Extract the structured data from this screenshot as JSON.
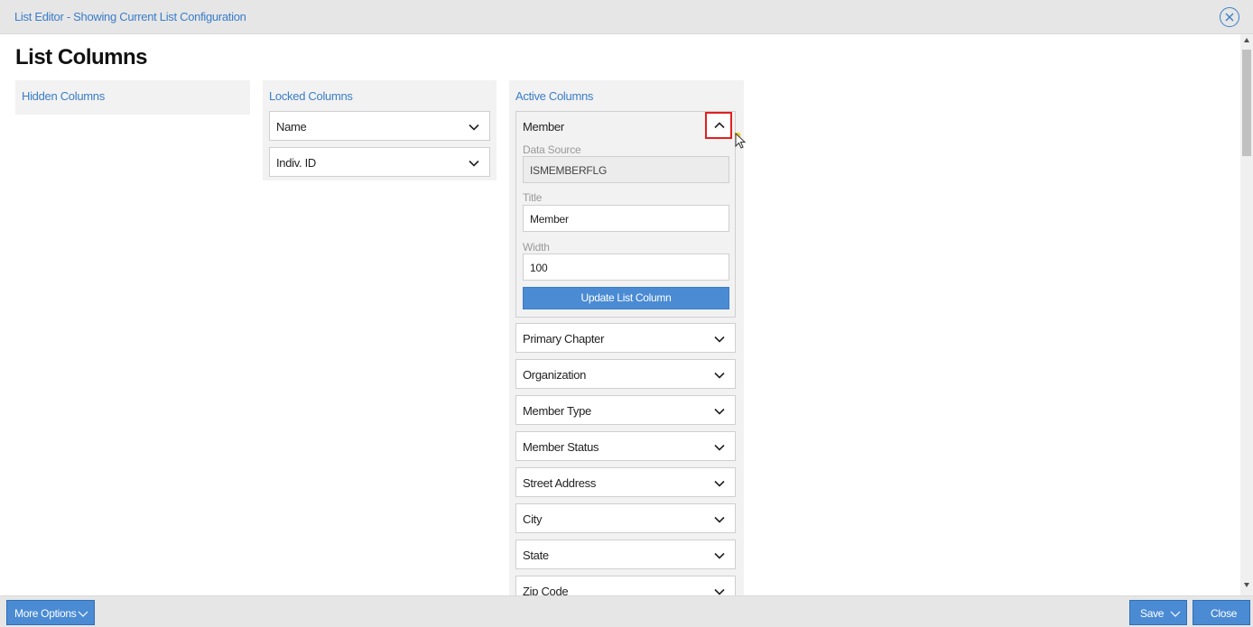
{
  "window": {
    "title": "List Editor - Showing Current List Configuration",
    "close_icon": "close-circle-icon"
  },
  "page": {
    "title": "List Columns"
  },
  "hidden_columns": {
    "title": "Hidden Columns",
    "items": []
  },
  "locked_columns": {
    "title": "Locked Columns",
    "items": [
      {
        "label": "Name"
      },
      {
        "label": "Indiv. ID"
      }
    ]
  },
  "active_columns": {
    "title": "Active Columns",
    "expanded": {
      "label": "Member",
      "data_source_label": "Data Source",
      "data_source_value": "ISMEMBERFLG",
      "title_label": "Title",
      "title_value": "Member",
      "width_label": "Width",
      "width_value": "100",
      "update_button": "Update List Column"
    },
    "items": [
      {
        "label": "Primary Chapter"
      },
      {
        "label": "Organization"
      },
      {
        "label": "Member Type"
      },
      {
        "label": "Member Status"
      },
      {
        "label": "Street Address"
      },
      {
        "label": "City"
      },
      {
        "label": "State"
      },
      {
        "label": "Zip Code"
      }
    ]
  },
  "footer": {
    "more_options": "More Options",
    "save": "Save",
    "close": "Close"
  },
  "colors": {
    "accent": "#3a7dc9",
    "button": "#4a8bd4",
    "highlight": "#e02020"
  }
}
